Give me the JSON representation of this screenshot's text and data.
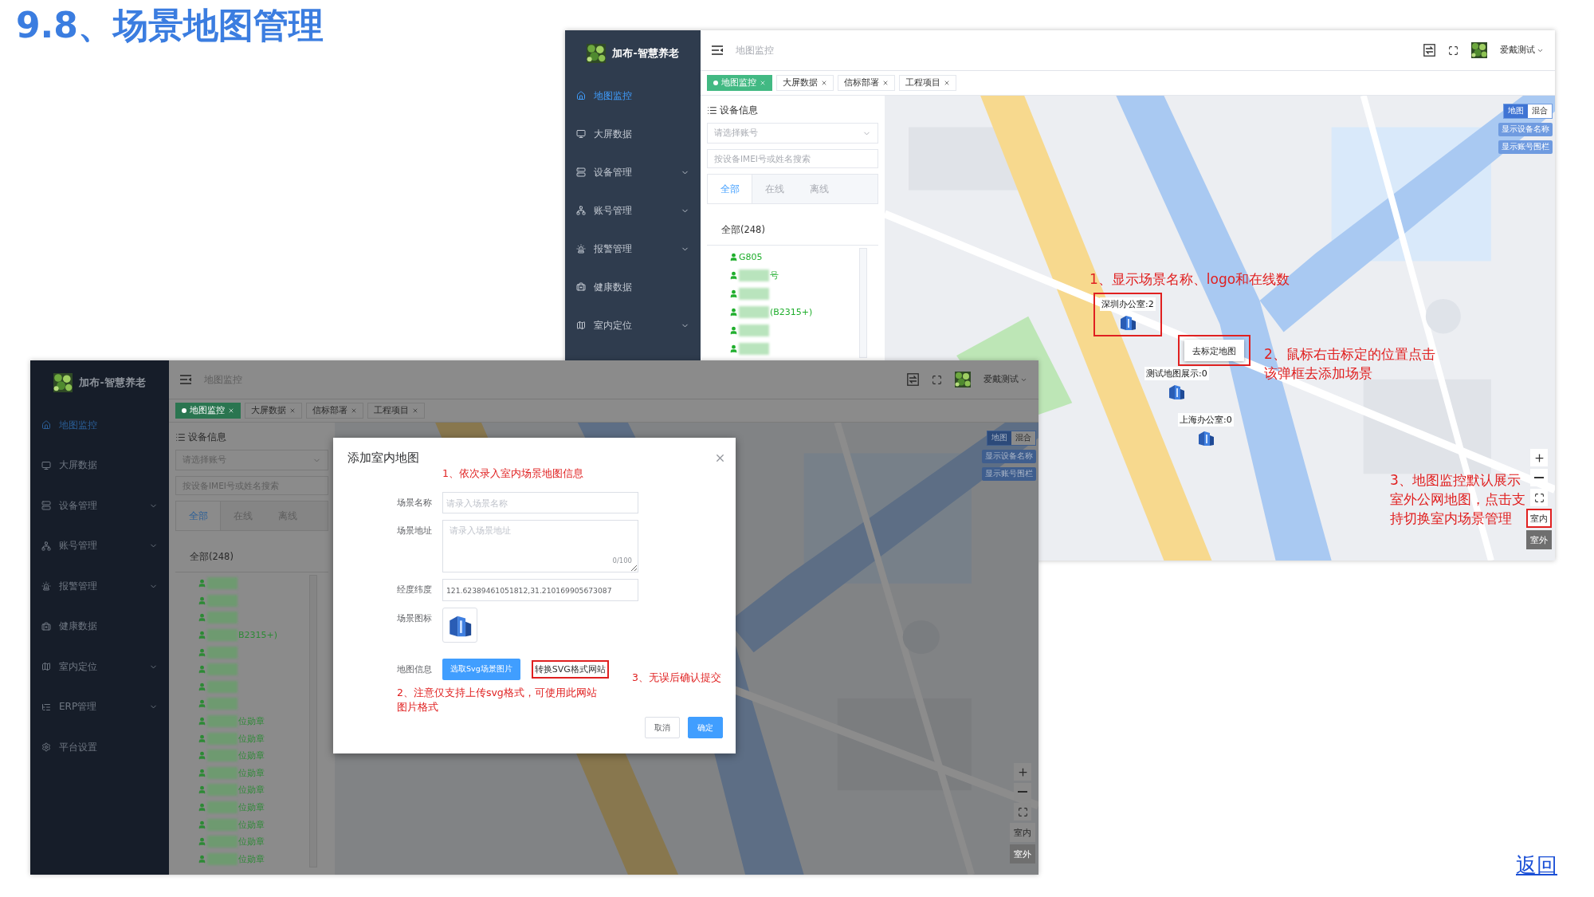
{
  "title": "9.8、场景地图管理",
  "screens": [
    {
      "app_name": "加布-智慧养老",
      "breadcrumb": "地图监控",
      "user_name": "爱戴测试",
      "sidebar": [
        {
          "label": "地图监控",
          "selected": true,
          "has_submenu": false
        },
        {
          "label": "大屏数据",
          "selected": false,
          "has_submenu": false
        },
        {
          "label": "设备管理",
          "selected": false,
          "has_submenu": true
        },
        {
          "label": "账号管理",
          "selected": false,
          "has_submenu": true
        },
        {
          "label": "报警管理",
          "selected": false,
          "has_submenu": true
        },
        {
          "label": "健康数据",
          "selected": false,
          "has_submenu": false
        },
        {
          "label": "室内定位",
          "selected": false,
          "has_submenu": true
        }
      ],
      "tabs": [
        {
          "label": "地图监控",
          "selected": true
        },
        {
          "label": "大屏数据",
          "selected": false
        },
        {
          "label": "信标部署",
          "selected": false
        },
        {
          "label": "工程项目",
          "selected": false
        }
      ],
      "panel": {
        "title": "设备信息",
        "account_select": {
          "placeholder": "请选择账号"
        },
        "search": {
          "placeholder": "按设备IMEI号或姓名搜索"
        },
        "filter_tabs": [
          {
            "label": "全部",
            "selected": true
          },
          {
            "label": "在线",
            "selected": false
          },
          {
            "label": "离线",
            "selected": false
          }
        ],
        "group_label": "全部(248)",
        "devices": [
          {
            "text": "G805",
            "redacted": false
          },
          {
            "text": "号",
            "redacted": true
          },
          {
            "redacted": true
          },
          {
            "text": "(B2315+)",
            "redacted": true
          },
          {
            "redacted": true
          },
          {
            "redacted": true
          }
        ]
      },
      "map": {
        "kind": "picture",
        "type_toggle": [
          {
            "label": "地图",
            "selected": true
          },
          {
            "label": "混合",
            "selected": false
          }
        ],
        "layer_buttons": [
          "显示设备名称",
          "显示账号围栏"
        ],
        "view_buttons": [
          {
            "label": "室内",
            "disabled": false,
            "highlighted": true
          },
          {
            "label": "室外",
            "disabled": true,
            "highlighted": false
          }
        ],
        "markers": [
          {
            "label": "深圳办公室:2",
            "highlighted": true
          },
          {
            "label": "测试地图展示:0",
            "highlighted": false
          },
          {
            "label": "上海办公室:0",
            "highlighted": false
          }
        ],
        "context_menu": {
          "items": [
            "去标定地图"
          ],
          "highlighted": true
        },
        "annotations": [
          "1、显示场景名称、logo和在线数",
          "2、鼠标右击标定的位置点击该弹框去添加场景",
          "3、地图监控默认展示室外公网地图，点击支持切换室内场景管理"
        ]
      }
    },
    {
      "app_name": "加布-智慧养老",
      "breadcrumb": "地图监控",
      "user_name": "爱戴测试",
      "sidebar": [
        {
          "label": "地图监控",
          "selected": true,
          "has_submenu": false
        },
        {
          "label": "大屏数据",
          "selected": false,
          "has_submenu": false
        },
        {
          "label": "设备管理",
          "selected": false,
          "has_submenu": true
        },
        {
          "label": "账号管理",
          "selected": false,
          "has_submenu": true
        },
        {
          "label": "报警管理",
          "selected": false,
          "has_submenu": true
        },
        {
          "label": "健康数据",
          "selected": false,
          "has_submenu": false
        },
        {
          "label": "室内定位",
          "selected": false,
          "has_submenu": true
        },
        {
          "label": "ERP管理",
          "selected": false,
          "has_submenu": true
        },
        {
          "label": "平台设置",
          "selected": false,
          "has_submenu": false
        }
      ],
      "tabs": [
        {
          "label": "地图监控",
          "selected": true
        },
        {
          "label": "大屏数据",
          "selected": false
        },
        {
          "label": "信标部署",
          "selected": false
        },
        {
          "label": "工程项目",
          "selected": false
        }
      ],
      "panel": {
        "title": "设备信息",
        "account_select": {
          "placeholder": "请选择账号"
        },
        "search": {
          "placeholder": "按设备IMEI号或姓名搜索"
        },
        "filter_tabs": [
          {
            "label": "全部",
            "selected": true
          },
          {
            "label": "在线",
            "selected": false
          },
          {
            "label": "离线",
            "selected": false
          }
        ],
        "group_label": "全部(248)",
        "devices": [
          {
            "redacted": true
          },
          {
            "redacted": true
          },
          {
            "redacted": true
          },
          {
            "text": "B2315+)",
            "redacted": true
          },
          {
            "redacted": true
          },
          {
            "redacted": true
          },
          {
            "redacted": true
          },
          {
            "redacted": true
          },
          {
            "text": "位勋章",
            "redacted": true
          },
          {
            "text": "位勋章",
            "redacted": true
          },
          {
            "text": "位勋章",
            "redacted": true
          },
          {
            "text": "位勋章",
            "redacted": true
          },
          {
            "text": "位勋章",
            "redacted": true
          },
          {
            "text": "位勋章",
            "redacted": true
          },
          {
            "text": "位勋章",
            "redacted": true
          },
          {
            "text": "位勋章",
            "redacted": true
          },
          {
            "text": "位勋章",
            "redacted": true
          }
        ]
      },
      "map": {
        "kind": "picture",
        "type_toggle": [
          {
            "label": "地图",
            "selected": true
          },
          {
            "label": "混合",
            "selected": false
          }
        ],
        "layer_buttons": [
          "显示设备名称",
          "显示账号围栏"
        ],
        "view_buttons": [
          {
            "label": "室内",
            "disabled": false,
            "highlighted": false
          },
          {
            "label": "室外",
            "disabled": true,
            "highlighted": false
          }
        ]
      },
      "dialog": {
        "title": "添加室内地图",
        "fields": [
          {
            "label": "场景名称",
            "kind": "input",
            "placeholder": "请录入场景名称"
          },
          {
            "label": "场景地址",
            "kind": "textarea",
            "placeholder": "请录入场景地址",
            "counter": "0/100"
          },
          {
            "label": "经度纬度",
            "kind": "input",
            "value": "121.62389461051812,31.210169905673087"
          },
          {
            "label": "场景图标"
          },
          {
            "label": "地图信息",
            "kind": "upload",
            "button": "选取Svg场景图片",
            "link": {
              "text": "转换SVG格式网站",
              "highlighted": true
            }
          }
        ],
        "buttons": [
          {
            "label": "取消",
            "primary": false
          },
          {
            "label": "确定",
            "primary": true
          }
        ],
        "annotations": [
          "1、依次录入室内场景地图信息",
          "2、注意仅支持上传svg格式，可使用此网站图片格式",
          "3、无误后确认提交"
        ]
      }
    }
  ],
  "back_link": "返回"
}
